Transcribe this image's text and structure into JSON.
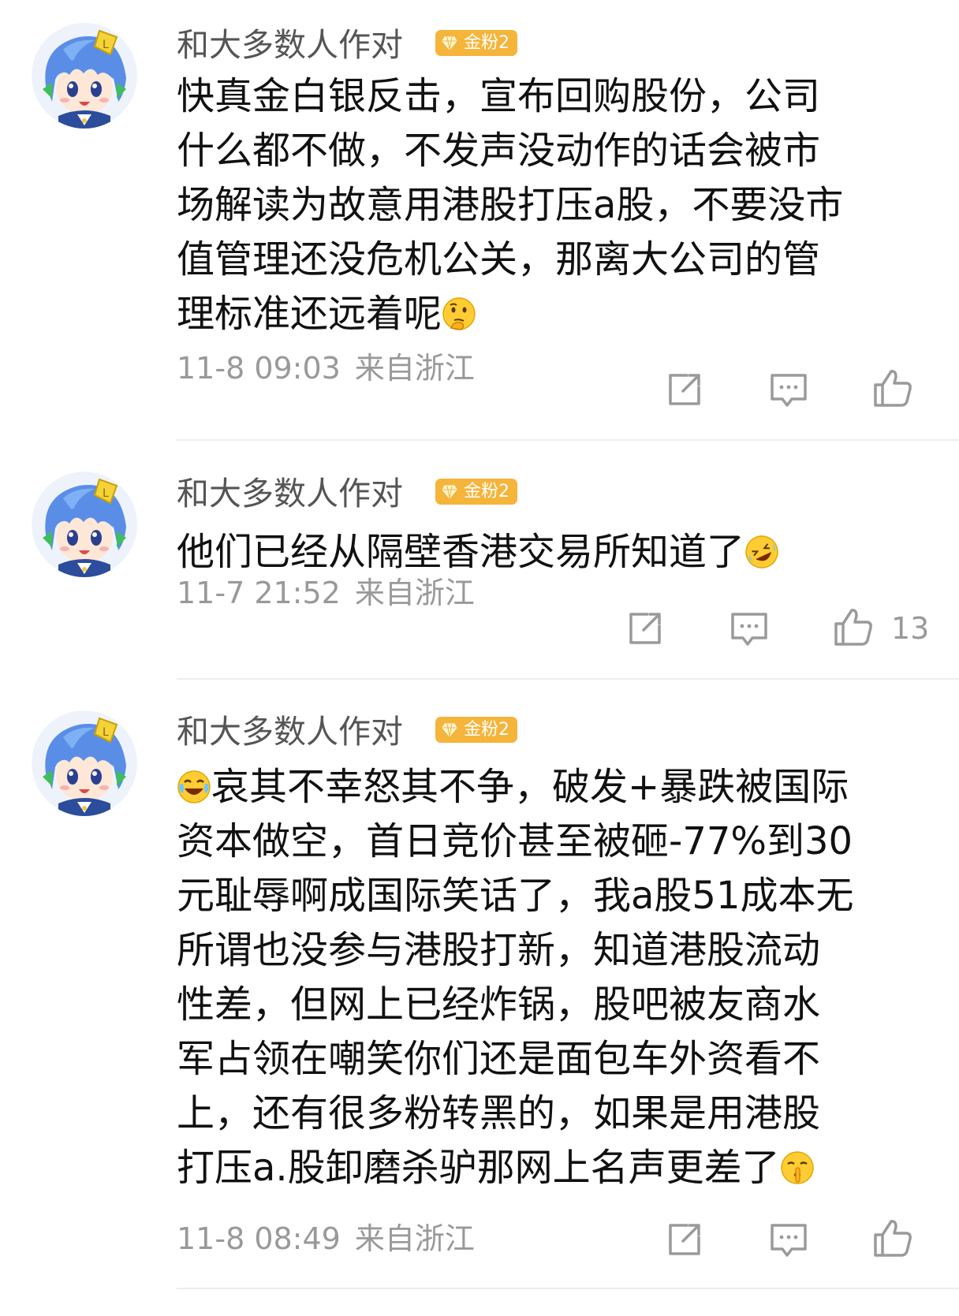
{
  "comments": [
    {
      "username": "和大多数人作对",
      "badge": "金粉2",
      "lines": [
        "快真金白银反击，宣布回购股份，公司",
        "什么都不做，不发声没动作的话会被市",
        "场解读为故意用港股打压a股，不要没市",
        "值管理还没危机公关，那离大公司的管",
        "理标准还远着呢"
      ],
      "emoji_end": "thinking-emoji",
      "time": "11-8 09:03",
      "location": "来自浙江",
      "likes": ""
    },
    {
      "username": "和大多数人作对",
      "badge": "金粉2",
      "lines": [
        "他们已经从隔壁香港交易所知道了"
      ],
      "emoji_end": "rofl-emoji",
      "time": "11-7 21:52",
      "location": "来自浙江",
      "likes": "13"
    },
    {
      "username": "和大多数人作对",
      "badge": "金粉2",
      "emoji_start": "laugh-cry-emoji",
      "lines": [
        "哀其不幸怒其不争，破发+暴跌被国际",
        "资本做空，首日竞价甚至被砸-77%到30",
        "元耻辱啊成国际笑话了，我a股51成本无",
        "所谓也没参与港股打新，知道港股流动",
        "性差，但网上已经炸锅，股吧被友商水",
        "军占领在嘲笑你们还是面包车外资看不",
        "上，还有很多粉转黑的，如果是用港股",
        "打压a.股卸磨杀驴那网上名声更差了"
      ],
      "emoji_end": "shush-emoji",
      "time": "11-8 08:49",
      "location": "来自浙江",
      "likes": ""
    }
  ],
  "colors": {
    "badge": "#f5b43a",
    "meta": "#999999",
    "text": "#111111",
    "divider": "#ededed"
  }
}
